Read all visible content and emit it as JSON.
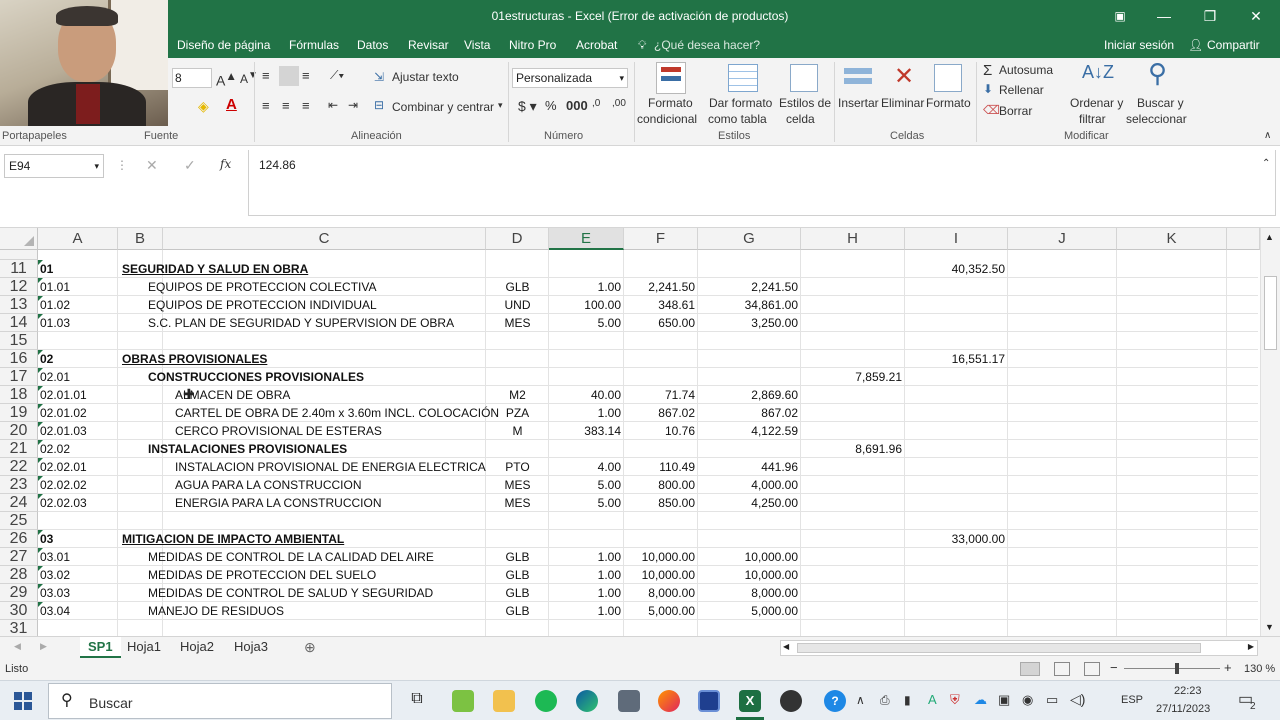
{
  "window": {
    "title": "01estructuras - Excel (Error de activación de productos)"
  },
  "menu": {
    "tabs": [
      "Diseño de página",
      "Fórmulas",
      "Datos",
      "Revisar",
      "Vista",
      "Nitro Pro",
      "Acrobat"
    ],
    "tell_me": "¿Qué desea hacer?",
    "sign_in": "Iniciar sesión",
    "share": "Compartir"
  },
  "ribbon": {
    "font_size": "8",
    "wrap_text": "Ajustar texto",
    "merge_center": "Combinar y centrar",
    "number_format": "Personalizada",
    "cond_format_1": "Formato",
    "cond_format_2": "condicional",
    "format_table_1": "Dar formato",
    "format_table_2": "como tabla",
    "cell_styles_1": "Estilos de",
    "cell_styles_2": "celda",
    "insert": "Insertar",
    "delete": "Eliminar",
    "format": "Formato",
    "autosum": "Autosuma",
    "fill": "Rellenar",
    "clear": "Borrar",
    "sort_1": "Ordenar y",
    "sort_2": "filtrar",
    "find_1": "Buscar y",
    "find_2": "seleccionar",
    "groups": {
      "clipboard": "Portapapeles",
      "font": "Fuente",
      "alignment": "Alineación",
      "number": "Número",
      "styles": "Estilos",
      "cells": "Celdas",
      "editing": "Modificar"
    }
  },
  "formula_bar": {
    "name_box": "E94",
    "fx": "fx",
    "value": "124.86"
  },
  "columns": [
    "A",
    "B",
    "C",
    "D",
    "E",
    "F",
    "G",
    "H",
    "I",
    "J",
    "K"
  ],
  "rows": [
    {
      "n": "11",
      "a": "01",
      "b": "SEGURIDAD Y SALUD EN OBRA",
      "b_style": "title",
      "c": "",
      "d": "",
      "e": "",
      "f": "",
      "g": "",
      "h": "",
      "i": "40,352.50"
    },
    {
      "n": "12",
      "a": "01.01",
      "b": "",
      "c": "EQUIPOS DE PROTECCION COLECTIVA",
      "c_indent": 1,
      "d": "GLB",
      "e": "1.00",
      "f": "2,241.50",
      "g": "2,241.50",
      "h": "",
      "i": ""
    },
    {
      "n": "13",
      "a": "01.02",
      "b": "",
      "c": "EQUIPOS DE PROTECCION INDIVIDUAL",
      "c_indent": 1,
      "d": "UND",
      "e": "100.00",
      "f": "348.61",
      "g": "34,861.00",
      "h": "",
      "i": ""
    },
    {
      "n": "14",
      "a": "01.03",
      "b": "",
      "c": "S.C. PLAN DE SEGURIDAD Y SUPERVISION DE OBRA",
      "c_indent": 1,
      "d": "MES",
      "e": "5.00",
      "f": "650.00",
      "g": "3,250.00",
      "h": "",
      "i": ""
    },
    {
      "n": "15",
      "a": "",
      "b": "",
      "c": "",
      "d": "",
      "e": "",
      "f": "",
      "g": "",
      "h": "",
      "i": ""
    },
    {
      "n": "16",
      "a": "02",
      "b": "OBRAS PROVISIONALES",
      "b_style": "title",
      "c": "",
      "d": "",
      "e": "",
      "f": "",
      "g": "",
      "h": "",
      "i": "16,551.17"
    },
    {
      "n": "17",
      "a": "02.01",
      "b": "",
      "c": "CONSTRUCCIONES PROVISIONALES",
      "c_indent": 1,
      "c_bold": true,
      "d": "",
      "e": "",
      "f": "",
      "g": "",
      "h": "7,859.21",
      "i": ""
    },
    {
      "n": "18",
      "a": "02.01.01",
      "b": "",
      "c": "ALMACEN DE OBRA",
      "c_indent": 2,
      "d": "M2",
      "e": "40.00",
      "f": "71.74",
      "g": "2,869.60",
      "h": "",
      "i": ""
    },
    {
      "n": "19",
      "a": "02.01.02",
      "b": "",
      "c": "CARTEL DE OBRA DE 2.40m x 3.60m INCL. COLOCACIÓN",
      "c_indent": 2,
      "d": "PZA",
      "e": "1.00",
      "f": "867.02",
      "g": "867.02",
      "h": "",
      "i": ""
    },
    {
      "n": "20",
      "a": "02.01.03",
      "b": "",
      "c": "CERCO PROVISIONAL DE ESTERAS",
      "c_indent": 2,
      "d": "M",
      "e": "383.14",
      "f": "10.76",
      "g": "4,122.59",
      "h": "",
      "i": ""
    },
    {
      "n": "21",
      "a": "02.02",
      "b": "",
      "c": "INSTALACIONES PROVISIONALES",
      "c_indent": 1,
      "c_bold": true,
      "d": "",
      "e": "",
      "f": "",
      "g": "",
      "h": "8,691.96",
      "i": ""
    },
    {
      "n": "22",
      "a": "02.02.01",
      "b": "",
      "c": "INSTALACION PROVISIONAL DE ENERGIA ELECTRICA",
      "c_indent": 2,
      "d": "PTO",
      "e": "4.00",
      "f": "110.49",
      "g": "441.96",
      "h": "",
      "i": ""
    },
    {
      "n": "23",
      "a": "02.02.02",
      "b": "",
      "c": "AGUA PARA LA CONSTRUCCION",
      "c_indent": 2,
      "d": "MES",
      "e": "5.00",
      "f": "800.00",
      "g": "4,000.00",
      "h": "",
      "i": ""
    },
    {
      "n": "24",
      "a": "02.02.03",
      "b": "",
      "c": "ENERGIA PARA LA CONSTRUCCION",
      "c_indent": 2,
      "d": "MES",
      "e": "5.00",
      "f": "850.00",
      "g": "4,250.00",
      "h": "",
      "i": ""
    },
    {
      "n": "25",
      "a": "",
      "b": "",
      "c": "",
      "d": "",
      "e": "",
      "f": "",
      "g": "",
      "h": "",
      "i": ""
    },
    {
      "n": "26",
      "a": "03",
      "b": "MITIGACION DE IMPACTO AMBIENTAL",
      "b_style": "title",
      "c": "",
      "d": "",
      "e": "",
      "f": "",
      "g": "",
      "h": "",
      "i": "33,000.00"
    },
    {
      "n": "27",
      "a": "03.01",
      "b": "",
      "c": "MEDIDAS DE CONTROL DE LA CALIDAD DEL AIRE",
      "c_indent": 1,
      "d": "GLB",
      "e": "1.00",
      "f": "10,000.00",
      "g": "10,000.00",
      "h": "",
      "i": ""
    },
    {
      "n": "28",
      "a": "03.02",
      "b": "",
      "c": "MEDIDAS DE PROTECCION DEL SUELO",
      "c_indent": 1,
      "d": "GLB",
      "e": "1.00",
      "f": "10,000.00",
      "g": "10,000.00",
      "h": "",
      "i": ""
    },
    {
      "n": "29",
      "a": "03.03",
      "b": "",
      "c": "MEDIDAS DE CONTROL DE SALUD Y SEGURIDAD",
      "c_indent": 1,
      "d": "GLB",
      "e": "1.00",
      "f": "8,000.00",
      "g": "8,000.00",
      "h": "",
      "i": ""
    },
    {
      "n": "30",
      "a": "03.04",
      "b": "",
      "c": "MANEJO DE RESIDUOS",
      "c_indent": 1,
      "d": "GLB",
      "e": "1.00",
      "f": "5,000.00",
      "g": "5,000.00",
      "h": "",
      "i": ""
    },
    {
      "n": "31",
      "a": "",
      "b": "",
      "c": "",
      "d": "",
      "e": "",
      "f": "",
      "g": "",
      "h": "",
      "i": ""
    }
  ],
  "sheets": [
    "SP1",
    "Hoja1",
    "Hoja2",
    "Hoja3"
  ],
  "active_sheet": "SP1",
  "status": {
    "ready": "Listo",
    "zoom": "130 %"
  },
  "taskbar": {
    "search": "Buscar",
    "lang": "ESP",
    "time": "22:23",
    "date": "27/11/2023",
    "notif_count": "2"
  },
  "colors": {
    "excel_green": "#217346",
    "ribbon_bg": "#f3f3f3"
  }
}
